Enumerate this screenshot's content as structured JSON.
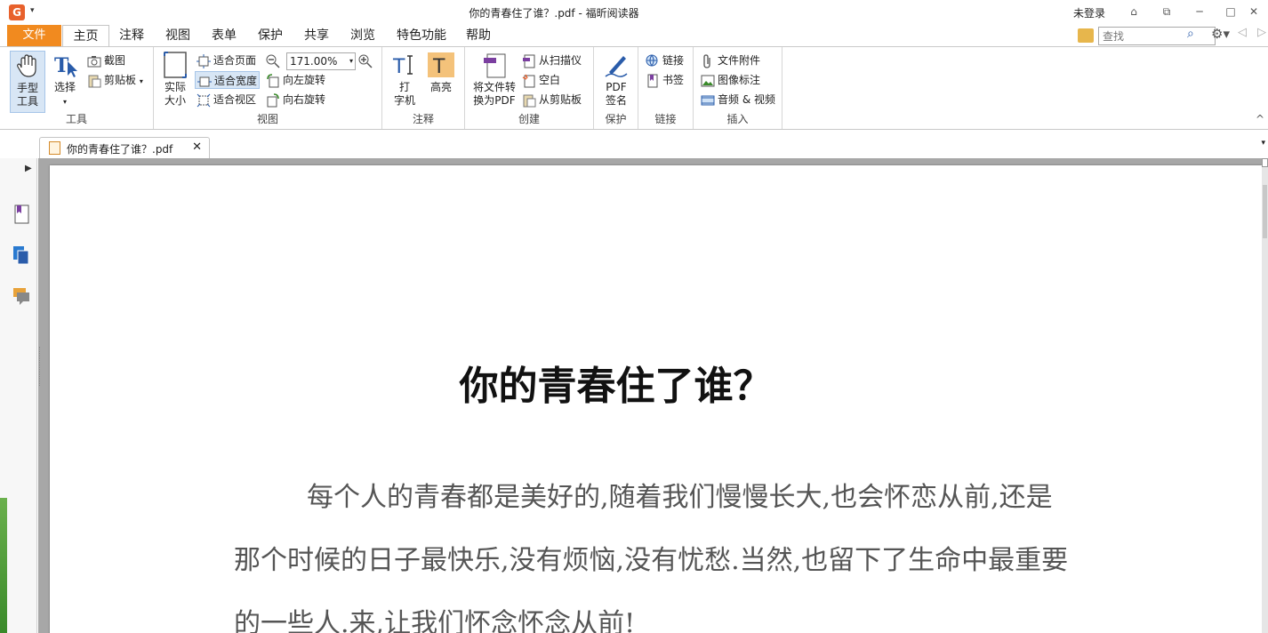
{
  "titlebar": {
    "logo": "G",
    "title": "你的青春住了谁？.pdf - 福昕阅读器",
    "login": "未登录",
    "icons": [
      "share-icon",
      "layout-icon",
      "minimize-icon",
      "maximize-icon",
      "close-icon"
    ],
    "btn_glyphs": [
      "⌂",
      "⧉",
      "─",
      "□",
      "✕"
    ]
  },
  "tabs": {
    "file": "文件",
    "items": [
      "主页",
      "注释",
      "视图",
      "表单",
      "保护",
      "共享",
      "浏览",
      "特色功能",
      "帮助"
    ],
    "active": "主页"
  },
  "search": {
    "placeholder": "查找",
    "value": "查找"
  },
  "ribbon": {
    "tools": {
      "label": "工具",
      "hand": "手型\n工具",
      "select": "选择",
      "snapshot": "截图",
      "clipboard": "剪贴板"
    },
    "view": {
      "label": "视图",
      "actual_size": "实际\n大小",
      "fit_page": "适合页面",
      "fit_width": "适合宽度",
      "fit_visible": "适合视区",
      "zoom": "171.00%",
      "rotate_left": "向左旋转",
      "rotate_right": "向右旋转"
    },
    "comment": {
      "label": "注释",
      "typewriter": "打\n字机",
      "highlight": "高亮"
    },
    "create": {
      "label": "创建",
      "convert": "将文件转\n换为PDF",
      "from_scanner": "从扫描仪",
      "blank": "空白",
      "from_clipboard": "从剪贴板"
    },
    "protect": {
      "label": "保护",
      "sign": "PDF\n签名"
    },
    "links": {
      "label": "链接",
      "link": "链接",
      "bookmark": "书签"
    },
    "insert": {
      "label": "插入",
      "attachment": "文件附件",
      "image": "图像标注",
      "media": "音频 & 视频"
    }
  },
  "doc_tab": {
    "label": "你的青春住了谁？.pdf"
  },
  "document": {
    "title": "你的青春住了谁？",
    "paragraph": "每个人的青春都是美好的,随着我们慢慢长大,也会怀恋从前,还是那个时候的日子最快乐,没有烦恼,没有忧愁.当然,也留下了生命中最重要的一些人.来,让我们怀念怀念从前!"
  },
  "colors": {
    "accent": "#f18a1f",
    "selected": "#d8e6f5",
    "doc_bg": "#a7a7a7"
  }
}
